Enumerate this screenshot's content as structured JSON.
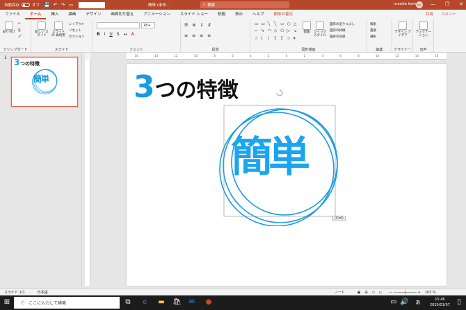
{
  "titlebar": {
    "autosave": "自動保存",
    "autosave_state": "オフ",
    "title": "簡単 (未作…",
    "search_placeholder": "検索",
    "user": "maeda kamari",
    "user_initials": "MK",
    "min": "—",
    "max": "❐",
    "close": "✕"
  },
  "menu": {
    "tabs": [
      "ファイル",
      "ホーム",
      "挿入",
      "描画",
      "デザイン",
      "画面切り替え",
      "アニメーション",
      "スライド ショー",
      "校閲",
      "表示",
      "ヘルプ",
      "図形の書式"
    ],
    "share": "共有",
    "comment": "コメント"
  },
  "ribbon": {
    "groups": [
      "クリップボード",
      "スライド",
      "フォント",
      "段落",
      "図形描画",
      "編集",
      "デザイナー",
      "音声"
    ],
    "paste": "貼り付け",
    "new_slide": "新しい スライド",
    "reuse_slide": "スライドの 再利用",
    "layout": "レイアウト",
    "reset": "リセット",
    "section": "セクション",
    "font_size": "18+",
    "arrange": "配置",
    "quick_style": "クイック スタイル",
    "fill": "図形の塗りつぶし",
    "outline": "図形の枠線",
    "effects": "図形の効果",
    "find": "検索",
    "replace": "置換",
    "select": "選択",
    "design_ideas": "デザイン アイデア",
    "dictate": "ディクテー ション"
  },
  "ruler": {
    "ticks": [
      "16",
      "14",
      "12",
      "10",
      "8",
      "6",
      "4",
      "2",
      "0",
      "2",
      "4",
      "6",
      "8",
      "10",
      "12",
      "14",
      "16"
    ]
  },
  "thumbnails": [
    {
      "number": "1",
      "title_num": "3",
      "title": "つの特徴",
      "word": "簡単"
    }
  ],
  "slide": {
    "title_num": "3",
    "title_text": "つの特徴",
    "word": "簡単",
    "paste_tag": "(Ctrl)",
    "accent": "#1a9be0"
  },
  "status": {
    "slide_info": "スライド 1/1",
    "language": "日本語",
    "notes": "ノート",
    "zoom": "103 %"
  },
  "taskbar": {
    "search": "ここに入力して検索",
    "time": "15:46",
    "date": "2020/01/07",
    "ime": "あ"
  }
}
